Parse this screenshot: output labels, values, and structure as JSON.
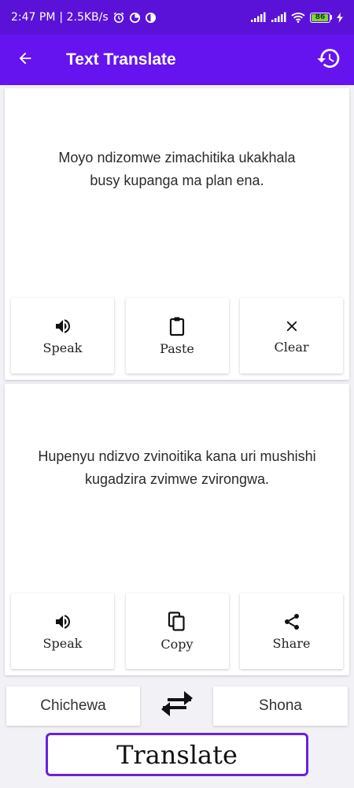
{
  "status_bar": {
    "time": "2:47 PM",
    "speed": "| 2.5KB/s",
    "battery": "86",
    "icons": [
      "alarm-icon",
      "data-saver-icon",
      "data-saver-icon",
      "signal-icon",
      "signal-icon",
      "wifi-icon",
      "battery-icon",
      "charging-icon"
    ]
  },
  "app_bar": {
    "title": "Text Translate",
    "icons": [
      "back-arrow-icon",
      "history-icon"
    ]
  },
  "source_panel": {
    "text": "Moyo ndizomwe zimachitika ukakhala busy kupanga ma plan ena.",
    "actions": [
      {
        "label": "Speak",
        "icon": "speaker-icon"
      },
      {
        "label": "Paste",
        "icon": "clipboard-icon"
      },
      {
        "label": "Clear",
        "icon": "close-icon"
      }
    ]
  },
  "result_panel": {
    "text": "Hupenyu ndizvo zvinoitika kana uri mushishi kugadzira zvimwe zvirongwa.",
    "actions": [
      {
        "label": "Speak",
        "icon": "speaker-icon"
      },
      {
        "label": "Copy",
        "icon": "copy-icon"
      },
      {
        "label": "Share",
        "icon": "share-icon"
      }
    ]
  },
  "languages": {
    "source": "Chichewa",
    "target": "Shona",
    "swap_icon": "swap-icon"
  },
  "translate_button": {
    "label": "Translate"
  },
  "colors": {
    "status_bar": "#5a12d8",
    "app_bar": "#6514f0",
    "translate_border": "#6a22e0",
    "battery_fill": "#7cd33a"
  }
}
